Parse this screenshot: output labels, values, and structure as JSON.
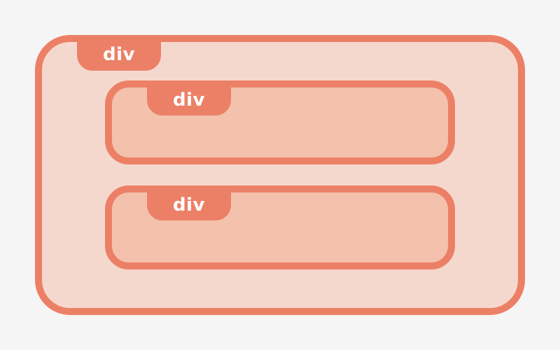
{
  "colors": {
    "background": "#f5f5f5",
    "border": "#ec8066",
    "outer_fill": "#f5d8cd",
    "inner_fill": "#f4c1ac",
    "tag_text": "#ffffff"
  },
  "diagram": {
    "outer": {
      "label": "div"
    },
    "children": [
      {
        "label": "div"
      },
      {
        "label": "div"
      }
    ]
  }
}
